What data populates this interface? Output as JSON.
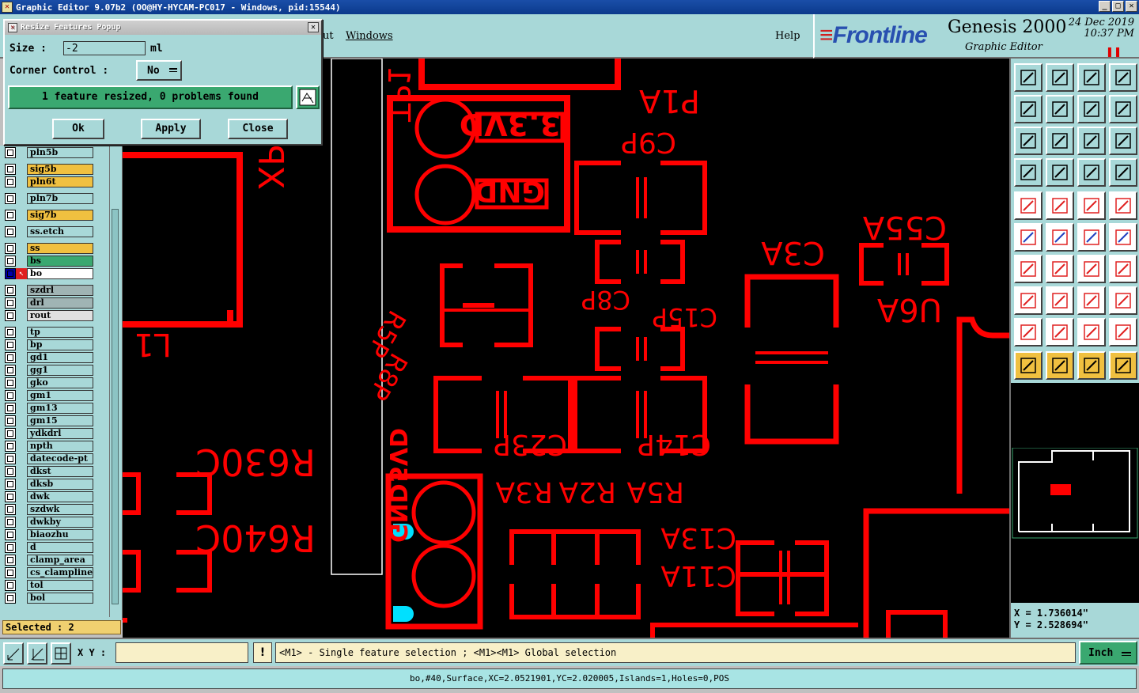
{
  "window": {
    "title": "Graphic Editor 9.07b2 (OO@HY-HYCAM-PC017 - Windows, pid:15544)"
  },
  "menu": {
    "items": [
      "ut",
      "Windows",
      "Help"
    ]
  },
  "brand": {
    "logo": "Frontline",
    "product": "Genesis 2000",
    "subtitle": "Graphic Editor",
    "date": "24 Dec 2019",
    "time": "10:37 PM"
  },
  "popup": {
    "title": "Resize Features Popup",
    "size_label": "Size :",
    "size_value": "-2",
    "size_unit": "ml",
    "corner_label": "Corner Control :",
    "corner_value": "No",
    "message": "1 feature resized, 0 problems found",
    "ok": "Ok",
    "apply": "Apply",
    "close": "Close"
  },
  "layers": [
    {
      "name": "pln5b",
      "color": "#a8d8d8",
      "mark": ""
    },
    {
      "name": "sig5b",
      "color": "#f0c040",
      "mark": "↙"
    },
    {
      "name": "pln6t",
      "color": "#f0c040",
      "mark": ""
    },
    {
      "name": "pln7b",
      "color": "#a8d8d8",
      "mark": ""
    },
    {
      "name": "sig7b",
      "color": "#f0c040",
      "mark": "↙"
    },
    {
      "name": "ss.etch",
      "color": "#a8d8d8",
      "mark": ""
    },
    {
      "name": "ss",
      "color": "#f0c040",
      "mark": "↙"
    },
    {
      "name": "bs",
      "color": "#3aa870",
      "mark": ""
    },
    {
      "name": "bo",
      "color": "#ffffff",
      "mark": "↙ ▣"
    },
    {
      "name": "szdrl",
      "color": "#a0b4b4",
      "mark": ""
    },
    {
      "name": "drl",
      "color": "#a0b4b4",
      "mark": ""
    },
    {
      "name": "rout",
      "color": "#e0e0e0",
      "mark": ""
    },
    {
      "name": "tp",
      "color": "#a8d8d8",
      "mark": ""
    },
    {
      "name": "bp",
      "color": "#a8d8d8",
      "mark": ""
    },
    {
      "name": "gd1",
      "color": "#a8d8d8",
      "mark": "↙"
    },
    {
      "name": "gg1",
      "color": "#a8d8d8",
      "mark": ""
    },
    {
      "name": "gko",
      "color": "#a8d8d8",
      "mark": ""
    },
    {
      "name": "gm1",
      "color": "#a8d8d8",
      "mark": ""
    },
    {
      "name": "gm13",
      "color": "#a8d8d8",
      "mark": "↙"
    },
    {
      "name": "gm15",
      "color": "#a8d8d8",
      "mark": ""
    },
    {
      "name": "ydkdrl",
      "color": "#a8d8d8",
      "mark": ""
    },
    {
      "name": "npth",
      "color": "#a8d8d8",
      "mark": ""
    },
    {
      "name": "datecode-pt",
      "color": "#a8d8d8",
      "mark": ""
    },
    {
      "name": "dkst",
      "color": "#a8d8d8",
      "mark": ""
    },
    {
      "name": "dksb",
      "color": "#a8d8d8",
      "mark": ""
    },
    {
      "name": "dwk",
      "color": "#a8d8d8",
      "mark": ""
    },
    {
      "name": "szdwk",
      "color": "#a8d8d8",
      "mark": ""
    },
    {
      "name": "dwkby",
      "color": "#a8d8d8",
      "mark": ""
    },
    {
      "name": "biaozhu",
      "color": "#a8d8d8",
      "mark": ""
    },
    {
      "name": "d",
      "color": "#a8d8d8",
      "mark": ""
    },
    {
      "name": "clamp_area",
      "color": "#a8d8d8",
      "mark": ""
    },
    {
      "name": "cs_clampline",
      "color": "#a8d8d8",
      "mark": ""
    },
    {
      "name": "tol",
      "color": "#a8d8d8",
      "mark": "↙"
    },
    {
      "name": "bol",
      "color": "#a8d8d8",
      "mark": "↙"
    }
  ],
  "selected": "Selected : 2",
  "pcb_labels": [
    "P1A",
    "C9P",
    "3.3VD",
    "GND",
    "TP1",
    "C3A",
    "C55A",
    "U6A",
    "C8P",
    "C15P",
    "R5P",
    "R8P",
    "C23P",
    "C14P",
    "R630C",
    "R640C",
    "R5A",
    "R2A",
    "R3A",
    "C13A",
    "C11A",
    "L1",
    "XP3C",
    "5VD",
    "GND"
  ],
  "coords": {
    "x": "X = 1.736014\"",
    "y": "Y = 2.528694\""
  },
  "bottom": {
    "xy_label": "X Y :",
    "xy_value": "",
    "hint": "<M1> - Single feature selection ; <M1><M1> Global selection",
    "unit": "Inch"
  },
  "status": "bo,#40,Surface,XC=2.0521901,YC=2.020005,Islands=1,Holes=0,POS",
  "colors": {
    "pcb": "#ff0000",
    "panel": "#a8d8d8",
    "accent": "#3aa870"
  }
}
